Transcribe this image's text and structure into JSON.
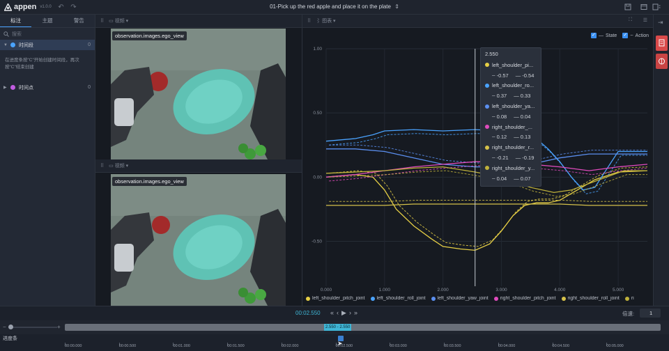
{
  "app": {
    "name": "appen",
    "version": "v1.0.0"
  },
  "task_title": "01-Pick up the red apple and place it on the plate",
  "sidebar": {
    "tabs": [
      {
        "label": "标注"
      },
      {
        "label": "主题"
      },
      {
        "label": "警告"
      }
    ],
    "search_placeholder": "搜索",
    "segments": {
      "label": "时间段",
      "count": "0",
      "color": "#4aa3ff"
    },
    "hint": "在进度条按\"C\"开始创建时间段，再次按\"C\"结束创建",
    "points": {
      "label": "时间点",
      "count": "0",
      "color": "#c15ce0"
    }
  },
  "video_panes": [
    {
      "type_label": "视频",
      "label": "observation.images.ego_view"
    },
    {
      "type_label": "视频",
      "label": "observation.images.ego_view"
    }
  ],
  "chart_header": {
    "type_label": "图表",
    "toggles": [
      {
        "label": "State",
        "checked": true
      },
      {
        "label": "Action",
        "checked": true
      }
    ]
  },
  "chart_data": {
    "type": "line",
    "xlim": [
      0,
      5.5
    ],
    "ylim": [
      -0.85,
      1.0
    ],
    "x_ticks": [
      "0.000",
      "1.000",
      "2.000",
      "3.000",
      "4.000",
      "5.000"
    ],
    "y_ticks": [
      "1.00",
      "0.50",
      "0.00",
      "-0.50"
    ],
    "cursor_x": 2.55,
    "series": [
      {
        "name": "left_shoulder_pitch_joint",
        "color": "#e6cf45",
        "x": [
          0,
          0.5,
          0.8,
          1.0,
          1.2,
          1.5,
          1.8,
          2.0,
          2.3,
          2.55,
          2.8,
          3.0,
          3.2,
          3.4,
          3.6,
          3.8,
          4.0,
          4.3,
          4.6,
          5.0,
          5.5
        ],
        "y": [
          0.0,
          0.02,
          0.0,
          -0.1,
          -0.25,
          -0.38,
          -0.48,
          -0.54,
          -0.56,
          -0.57,
          -0.52,
          -0.42,
          -0.3,
          -0.22,
          -0.2,
          -0.2,
          -0.18,
          -0.1,
          -0.02,
          0.04,
          0.05
        ]
      },
      {
        "name": "left_shoulder_roll_joint",
        "color": "#4aa3ff",
        "x": [
          0,
          0.5,
          0.8,
          1.0,
          1.5,
          2.0,
          2.55,
          3.0,
          3.4,
          3.6,
          3.8,
          4.0,
          4.2,
          4.4,
          4.6,
          4.8,
          5.0,
          5.5
        ],
        "y": [
          0.28,
          0.3,
          0.33,
          0.36,
          0.37,
          0.36,
          0.37,
          0.36,
          0.34,
          0.3,
          0.22,
          0.12,
          0.0,
          -0.1,
          -0.08,
          0.06,
          0.2,
          0.2
        ]
      },
      {
        "name": "left_shoulder_yaw_joint",
        "color": "#5b8ff0",
        "x": [
          0,
          0.5,
          1.0,
          1.5,
          2.0,
          2.55,
          3.0,
          3.5,
          4.0,
          4.5,
          5.0,
          5.5
        ],
        "y": [
          0.22,
          0.22,
          0.2,
          0.15,
          0.1,
          0.08,
          0.08,
          0.1,
          0.15,
          0.18,
          0.18,
          0.18
        ]
      },
      {
        "name": "right_shoulder_pitch_joint",
        "color": "#e04bbd",
        "x": [
          0,
          0.5,
          1.0,
          1.5,
          2.0,
          2.55,
          3.0,
          3.5,
          4.0,
          4.5,
          5.0,
          5.5
        ],
        "y": [
          0.0,
          0.02,
          0.05,
          0.08,
          0.1,
          0.12,
          0.12,
          0.1,
          0.08,
          0.05,
          0.08,
          0.1
        ]
      },
      {
        "name": "right_shoulder_roll_joint",
        "color": "#d6c24a",
        "x": [
          0,
          0.5,
          1.0,
          1.5,
          2.0,
          2.55,
          3.0,
          3.5,
          4.0,
          4.5,
          5.0,
          5.5
        ],
        "y": [
          -0.22,
          -0.22,
          -0.22,
          -0.21,
          -0.21,
          -0.21,
          -0.21,
          -0.21,
          -0.21,
          -0.22,
          -0.22,
          -0.22
        ]
      },
      {
        "name": "right_shoulder_yaw_joint",
        "color": "#bfb13b",
        "x": [
          0,
          0.5,
          1.0,
          1.5,
          2.0,
          2.55,
          3.0,
          3.5,
          3.9,
          4.2,
          4.5,
          4.8,
          5.1,
          5.5
        ],
        "y": [
          0.03,
          0.04,
          0.05,
          0.07,
          0.08,
          0.04,
          0.0,
          -0.08,
          -0.12,
          -0.1,
          -0.05,
          0.0,
          0.05,
          0.05
        ]
      }
    ],
    "legend": [
      "left_shoulder_pitch_joint",
      "left_shoulder_roll_joint",
      "left_shoulder_yaw_joint",
      "right_shoulder_pitch_joint",
      "right_shoulder_roll_joint",
      "ri"
    ]
  },
  "tooltip": {
    "time": "2.550",
    "rows": [
      {
        "name": "left_shoulder_pi...",
        "color": "#e6cf45",
        "state": "-0.57",
        "action": "-0.54"
      },
      {
        "name": "left_shoulder_ro...",
        "color": "#4aa3ff",
        "state": "0.37",
        "action": "0.33"
      },
      {
        "name": "left_shoulder_ya...",
        "color": "#5b8ff0",
        "state": "0.08",
        "action": "0.04"
      },
      {
        "name": "right_shoulder_...",
        "color": "#e04bbd",
        "state": "0.12",
        "action": "0.13"
      },
      {
        "name": "right_shoulder_r...",
        "color": "#d6c24a",
        "state": "-0.21",
        "action": "-0.19"
      },
      {
        "name": "right_shoulder_y...",
        "color": "#bfb13b",
        "state": "0.04",
        "action": "0.07"
      }
    ]
  },
  "playback": {
    "current_time": "00:02.550",
    "speed_label": "倍速:",
    "speed_value": "1"
  },
  "timeline": {
    "track_label": "进度条",
    "range_label": "2.550 - 2.550",
    "ticks": [
      "00:00.000",
      "00:00.500",
      "00:01.000",
      "00:01.500",
      "00:02.000",
      "00:02.500",
      "00:03.000",
      "00:03.500",
      "00:04.000",
      "00:04.500",
      "00:05.000"
    ],
    "zoom_minus": "−",
    "zoom_plus": "+"
  }
}
